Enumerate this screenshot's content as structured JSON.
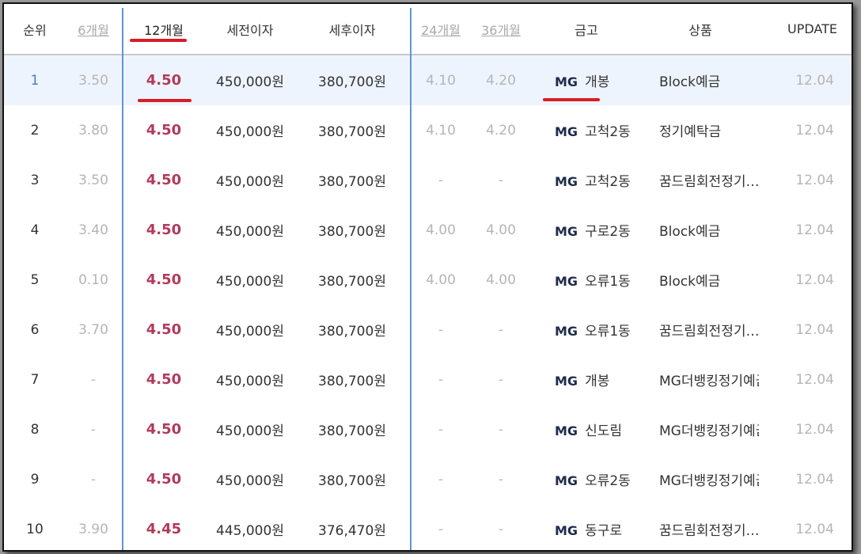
{
  "header": {
    "rank": "순위",
    "m6": "6개월",
    "m12": "12개월",
    "pre_tax": "세전이자",
    "post_tax": "세후이자",
    "m24": "24개월",
    "m36": "36개월",
    "bank": "금고",
    "product": "상품",
    "update": "UPDATE"
  },
  "bank_prefix": "MG",
  "rows": [
    {
      "rank": "1",
      "m6": "3.50",
      "m12": "4.50",
      "pre": "450,000원",
      "post": "380,700원",
      "m24": "4.10",
      "m36": "4.20",
      "bank": "개봉",
      "product": "Block예금",
      "update": "12.04"
    },
    {
      "rank": "2",
      "m6": "3.80",
      "m12": "4.50",
      "pre": "450,000원",
      "post": "380,700원",
      "m24": "4.10",
      "m36": "4.20",
      "bank": "고척2동",
      "product": "정기예탁금",
      "update": "12.04"
    },
    {
      "rank": "3",
      "m6": "3.50",
      "m12": "4.50",
      "pre": "450,000원",
      "post": "380,700원",
      "m24": "-",
      "m36": "-",
      "bank": "고척2동",
      "product": "꿈드림회전정기…",
      "update": "12.04"
    },
    {
      "rank": "4",
      "m6": "3.40",
      "m12": "4.50",
      "pre": "450,000원",
      "post": "380,700원",
      "m24": "4.00",
      "m36": "4.00",
      "bank": "구로2동",
      "product": "Block예금",
      "update": "12.04"
    },
    {
      "rank": "5",
      "m6": "0.10",
      "m12": "4.50",
      "pre": "450,000원",
      "post": "380,700원",
      "m24": "4.00",
      "m36": "4.00",
      "bank": "오류1동",
      "product": "Block예금",
      "update": "12.04"
    },
    {
      "rank": "6",
      "m6": "3.70",
      "m12": "4.50",
      "pre": "450,000원",
      "post": "380,700원",
      "m24": "-",
      "m36": "-",
      "bank": "오류1동",
      "product": "꿈드림회전정기…",
      "update": "12.04"
    },
    {
      "rank": "7",
      "m6": "-",
      "m12": "4.50",
      "pre": "450,000원",
      "post": "380,700원",
      "m24": "-",
      "m36": "-",
      "bank": "개봉",
      "product": "MG더뱅킹정기예금",
      "update": "12.04"
    },
    {
      "rank": "8",
      "m6": "-",
      "m12": "4.50",
      "pre": "450,000원",
      "post": "380,700원",
      "m24": "-",
      "m36": "-",
      "bank": "신도림",
      "product": "MG더뱅킹정기예금",
      "update": "12.04"
    },
    {
      "rank": "9",
      "m6": "-",
      "m12": "4.50",
      "pre": "450,000원",
      "post": "380,700원",
      "m24": "-",
      "m36": "-",
      "bank": "오류2동",
      "product": "MG더뱅킹정기예금",
      "update": "12.04"
    },
    {
      "rank": "10",
      "m6": "3.90",
      "m12": "4.45",
      "pre": "445,000원",
      "post": "376,470원",
      "m24": "-",
      "m36": "-",
      "bank": "동구로",
      "product": "꿈드림회전정기…",
      "update": "12.04"
    }
  ],
  "colors": {
    "rate": "#b23a5a",
    "highlight_row": "#eef4fd",
    "column_divider": "#5f95d6",
    "annotation_underline": "#d91c26"
  }
}
